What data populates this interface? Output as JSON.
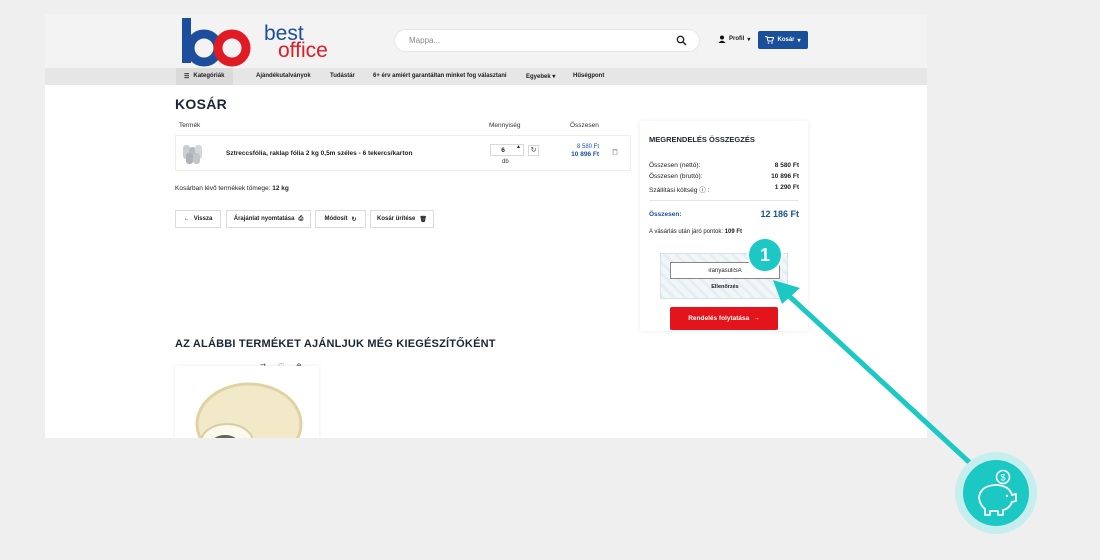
{
  "logo": {
    "line1": "best",
    "line2": "office"
  },
  "header": {
    "search_placeholder": "Mappa...",
    "profile_label": "Profil",
    "cart_label": "Kosár"
  },
  "nav": {
    "categories": "Kategóriák",
    "items": [
      "Ajándékutalványok",
      "Tudástár",
      "6+ érv amiért garantáltan minket fog választani",
      "Egyebek",
      "Hűségpont"
    ]
  },
  "cart": {
    "title": "KOSÁR",
    "columns": {
      "product": "Termék",
      "quantity": "Mennyiség",
      "total": "Összesen"
    },
    "item": {
      "name": "Sztreccsfólia, raklap fólia 2 kg 0,5m széles - 6 tekercs/karton",
      "quantity": "6",
      "unit": "db",
      "unit_price": "8 580 Ft",
      "total_price": "10 896 Ft"
    },
    "weight_label": "Kosárban lévő termékek tömege:",
    "weight_value": "12 kg",
    "actions": {
      "back": "Vissza",
      "print": "Árajánlat nyomtatása",
      "update": "Módosít",
      "clear": "Kosár ürítése"
    }
  },
  "summary": {
    "title": "MEGRENDELÉS ÖSSZEGZÉS",
    "net_label": "Összesen (nettó):",
    "net_value": "8 580 Ft",
    "gross_label": "Összesen (bruttó):",
    "gross_value": "10 896 Ft",
    "shipping_label": "Szállítási költség",
    "shipping_value": "1 290 Ft",
    "total_label": "Összesen:",
    "total_value": "12 186 Ft",
    "points_label": "A vásárlás után járó pontok:",
    "points_value": "109 Ft",
    "coupon_value": "iranyasuliSA",
    "check_label": "Ellenőrzés",
    "order_label": "Rendelés folytatása"
  },
  "recommend": {
    "title": "AZ ALÁBBI TERMÉKET AJÁNLJUK MÉG KIEGÉSZÍTŐKÉNT"
  },
  "annotation": {
    "step": "1"
  },
  "colors": {
    "brand_blue": "#1a4f9c",
    "brand_red": "#e3141b",
    "teal": "#1cc8c4"
  }
}
